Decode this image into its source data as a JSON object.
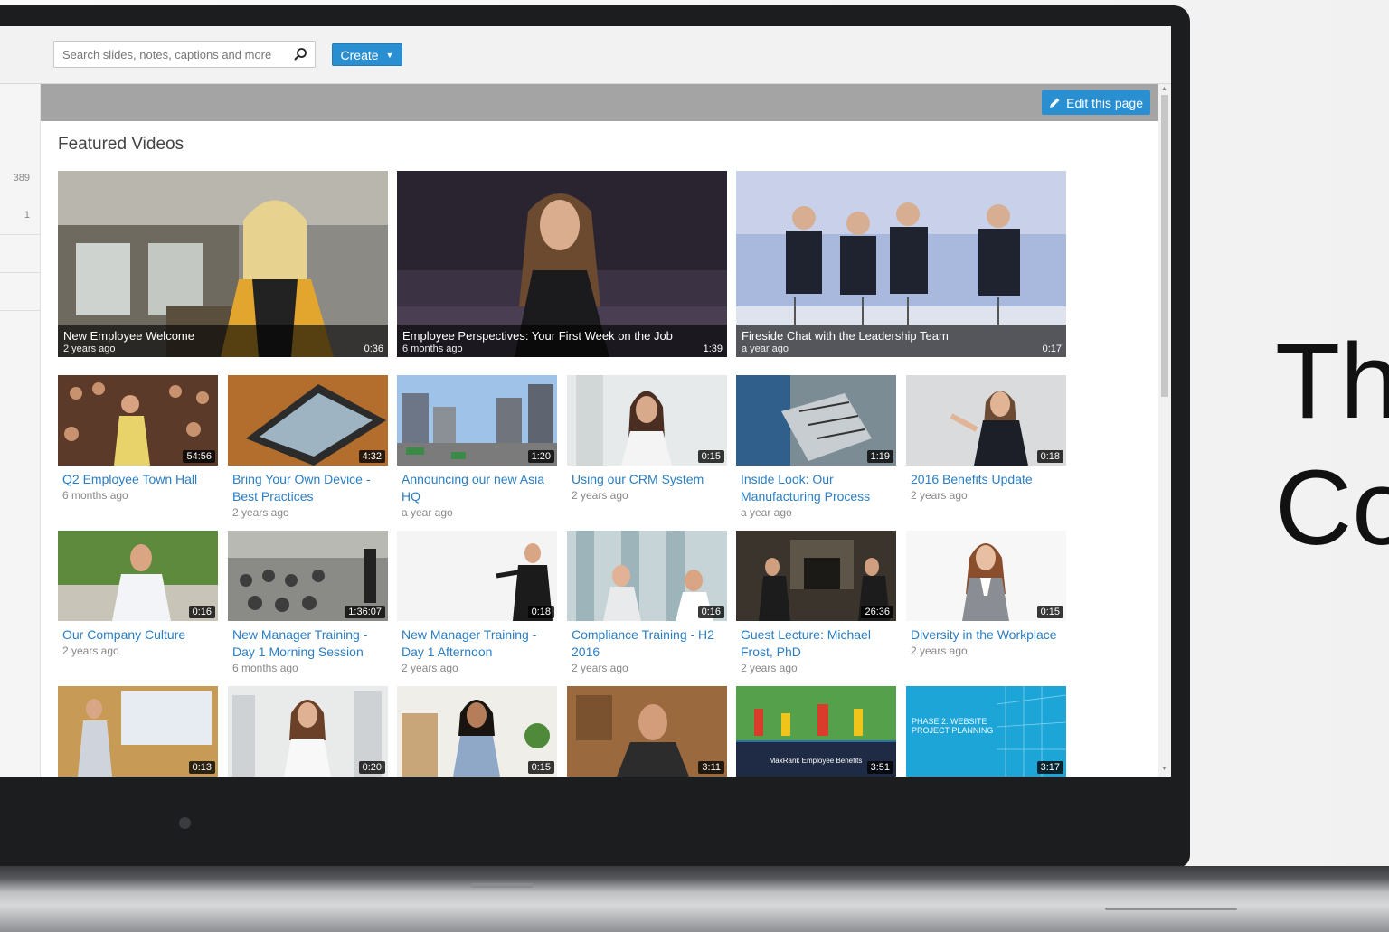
{
  "search": {
    "placeholder": "Search slides, notes, captions and more"
  },
  "create_label": "Create",
  "edit_label": "Edit this page",
  "left_counts": [
    "389",
    "1"
  ],
  "section_title": "Featured Videos",
  "featured": [
    {
      "title": "New Employee Welcome",
      "age": "2 years ago",
      "duration": "0:36"
    },
    {
      "title": "Employee Perspectives: Your First Week on the Job",
      "age": "6 months ago",
      "duration": "1:39"
    },
    {
      "title": "Fireside Chat with the Leadership Team",
      "age": "a year ago",
      "duration": "0:17"
    }
  ],
  "row1": [
    {
      "title": "Q2 Employee Town Hall",
      "age": "6 months ago",
      "duration": "54:56"
    },
    {
      "title": "Bring Your Own Device - Best Practices",
      "age": "2 years ago",
      "duration": "4:32"
    },
    {
      "title": "Announcing our new Asia HQ",
      "age": "a year ago",
      "duration": "1:20"
    },
    {
      "title": "Using our CRM System",
      "age": "2 years ago",
      "duration": "0:15"
    },
    {
      "title": "Inside Look: Our Manufacturing Process",
      "age": "a year ago",
      "duration": "1:19"
    },
    {
      "title": "2016 Benefits Update",
      "age": "2 years ago",
      "duration": "0:18"
    }
  ],
  "row2": [
    {
      "title": "Our Company Culture",
      "age": "2 years ago",
      "duration": "0:16"
    },
    {
      "title": "New Manager Training - Day 1 Morning Session",
      "age": "6 months ago",
      "duration": "1:36:07"
    },
    {
      "title": "New Manager Training - Day 1 Afternoon",
      "age": "2 years ago",
      "duration": "0:18"
    },
    {
      "title": "Compliance Training - H2 2016",
      "age": "2 years ago",
      "duration": "0:16"
    },
    {
      "title": "Guest Lecture: Michael Frost, PhD",
      "age": "2 years ago",
      "duration": "26:36"
    },
    {
      "title": "Diversity in the Workplace",
      "age": "2 years ago",
      "duration": "0:15"
    }
  ],
  "row3": [
    {
      "duration": "0:13"
    },
    {
      "duration": "0:20"
    },
    {
      "duration": "0:15"
    },
    {
      "duration": "3:11"
    },
    {
      "duration": "3:51",
      "caption": "MaxRank Employee Benefits"
    },
    {
      "duration": "3:17",
      "caption": "PHASE 2: WEBSITE PROJECT PLANNING"
    }
  ],
  "side_text": "Th\nCo",
  "colors": {
    "accent": "#2a8fd0",
    "link": "#2a7ec4",
    "banner": "#a4a4a4"
  }
}
